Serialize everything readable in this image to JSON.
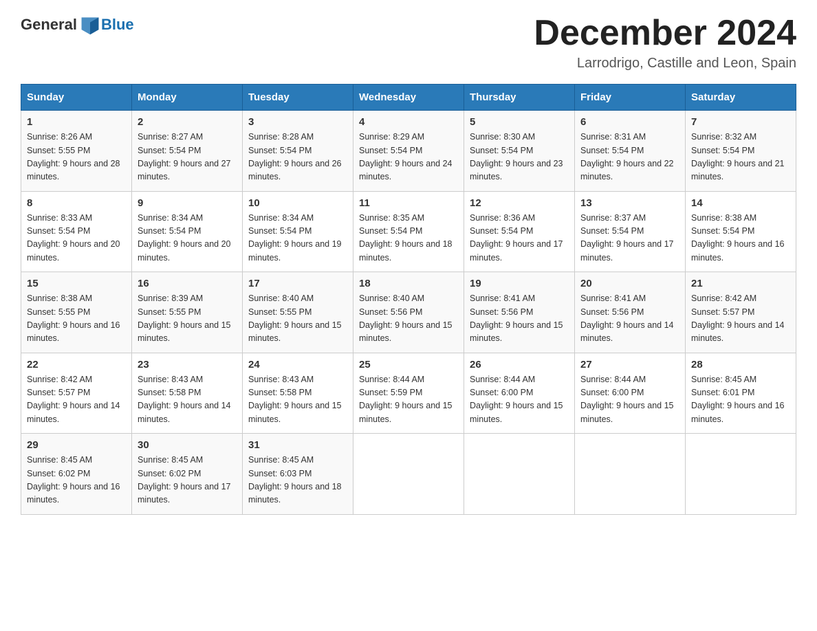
{
  "header": {
    "logo_text_general": "General",
    "logo_text_blue": "Blue",
    "month_title": "December 2024",
    "location": "Larrodrigo, Castille and Leon, Spain"
  },
  "days_of_week": [
    "Sunday",
    "Monday",
    "Tuesday",
    "Wednesday",
    "Thursday",
    "Friday",
    "Saturday"
  ],
  "weeks": [
    [
      {
        "day": "1",
        "sunrise": "Sunrise: 8:26 AM",
        "sunset": "Sunset: 5:55 PM",
        "daylight": "Daylight: 9 hours and 28 minutes."
      },
      {
        "day": "2",
        "sunrise": "Sunrise: 8:27 AM",
        "sunset": "Sunset: 5:54 PM",
        "daylight": "Daylight: 9 hours and 27 minutes."
      },
      {
        "day": "3",
        "sunrise": "Sunrise: 8:28 AM",
        "sunset": "Sunset: 5:54 PM",
        "daylight": "Daylight: 9 hours and 26 minutes."
      },
      {
        "day": "4",
        "sunrise": "Sunrise: 8:29 AM",
        "sunset": "Sunset: 5:54 PM",
        "daylight": "Daylight: 9 hours and 24 minutes."
      },
      {
        "day": "5",
        "sunrise": "Sunrise: 8:30 AM",
        "sunset": "Sunset: 5:54 PM",
        "daylight": "Daylight: 9 hours and 23 minutes."
      },
      {
        "day": "6",
        "sunrise": "Sunrise: 8:31 AM",
        "sunset": "Sunset: 5:54 PM",
        "daylight": "Daylight: 9 hours and 22 minutes."
      },
      {
        "day": "7",
        "sunrise": "Sunrise: 8:32 AM",
        "sunset": "Sunset: 5:54 PM",
        "daylight": "Daylight: 9 hours and 21 minutes."
      }
    ],
    [
      {
        "day": "8",
        "sunrise": "Sunrise: 8:33 AM",
        "sunset": "Sunset: 5:54 PM",
        "daylight": "Daylight: 9 hours and 20 minutes."
      },
      {
        "day": "9",
        "sunrise": "Sunrise: 8:34 AM",
        "sunset": "Sunset: 5:54 PM",
        "daylight": "Daylight: 9 hours and 20 minutes."
      },
      {
        "day": "10",
        "sunrise": "Sunrise: 8:34 AM",
        "sunset": "Sunset: 5:54 PM",
        "daylight": "Daylight: 9 hours and 19 minutes."
      },
      {
        "day": "11",
        "sunrise": "Sunrise: 8:35 AM",
        "sunset": "Sunset: 5:54 PM",
        "daylight": "Daylight: 9 hours and 18 minutes."
      },
      {
        "day": "12",
        "sunrise": "Sunrise: 8:36 AM",
        "sunset": "Sunset: 5:54 PM",
        "daylight": "Daylight: 9 hours and 17 minutes."
      },
      {
        "day": "13",
        "sunrise": "Sunrise: 8:37 AM",
        "sunset": "Sunset: 5:54 PM",
        "daylight": "Daylight: 9 hours and 17 minutes."
      },
      {
        "day": "14",
        "sunrise": "Sunrise: 8:38 AM",
        "sunset": "Sunset: 5:54 PM",
        "daylight": "Daylight: 9 hours and 16 minutes."
      }
    ],
    [
      {
        "day": "15",
        "sunrise": "Sunrise: 8:38 AM",
        "sunset": "Sunset: 5:55 PM",
        "daylight": "Daylight: 9 hours and 16 minutes."
      },
      {
        "day": "16",
        "sunrise": "Sunrise: 8:39 AM",
        "sunset": "Sunset: 5:55 PM",
        "daylight": "Daylight: 9 hours and 15 minutes."
      },
      {
        "day": "17",
        "sunrise": "Sunrise: 8:40 AM",
        "sunset": "Sunset: 5:55 PM",
        "daylight": "Daylight: 9 hours and 15 minutes."
      },
      {
        "day": "18",
        "sunrise": "Sunrise: 8:40 AM",
        "sunset": "Sunset: 5:56 PM",
        "daylight": "Daylight: 9 hours and 15 minutes."
      },
      {
        "day": "19",
        "sunrise": "Sunrise: 8:41 AM",
        "sunset": "Sunset: 5:56 PM",
        "daylight": "Daylight: 9 hours and 15 minutes."
      },
      {
        "day": "20",
        "sunrise": "Sunrise: 8:41 AM",
        "sunset": "Sunset: 5:56 PM",
        "daylight": "Daylight: 9 hours and 14 minutes."
      },
      {
        "day": "21",
        "sunrise": "Sunrise: 8:42 AM",
        "sunset": "Sunset: 5:57 PM",
        "daylight": "Daylight: 9 hours and 14 minutes."
      }
    ],
    [
      {
        "day": "22",
        "sunrise": "Sunrise: 8:42 AM",
        "sunset": "Sunset: 5:57 PM",
        "daylight": "Daylight: 9 hours and 14 minutes."
      },
      {
        "day": "23",
        "sunrise": "Sunrise: 8:43 AM",
        "sunset": "Sunset: 5:58 PM",
        "daylight": "Daylight: 9 hours and 14 minutes."
      },
      {
        "day": "24",
        "sunrise": "Sunrise: 8:43 AM",
        "sunset": "Sunset: 5:58 PM",
        "daylight": "Daylight: 9 hours and 15 minutes."
      },
      {
        "day": "25",
        "sunrise": "Sunrise: 8:44 AM",
        "sunset": "Sunset: 5:59 PM",
        "daylight": "Daylight: 9 hours and 15 minutes."
      },
      {
        "day": "26",
        "sunrise": "Sunrise: 8:44 AM",
        "sunset": "Sunset: 6:00 PM",
        "daylight": "Daylight: 9 hours and 15 minutes."
      },
      {
        "day": "27",
        "sunrise": "Sunrise: 8:44 AM",
        "sunset": "Sunset: 6:00 PM",
        "daylight": "Daylight: 9 hours and 15 minutes."
      },
      {
        "day": "28",
        "sunrise": "Sunrise: 8:45 AM",
        "sunset": "Sunset: 6:01 PM",
        "daylight": "Daylight: 9 hours and 16 minutes."
      }
    ],
    [
      {
        "day": "29",
        "sunrise": "Sunrise: 8:45 AM",
        "sunset": "Sunset: 6:02 PM",
        "daylight": "Daylight: 9 hours and 16 minutes."
      },
      {
        "day": "30",
        "sunrise": "Sunrise: 8:45 AM",
        "sunset": "Sunset: 6:02 PM",
        "daylight": "Daylight: 9 hours and 17 minutes."
      },
      {
        "day": "31",
        "sunrise": "Sunrise: 8:45 AM",
        "sunset": "Sunset: 6:03 PM",
        "daylight": "Daylight: 9 hours and 18 minutes."
      },
      null,
      null,
      null,
      null
    ]
  ]
}
